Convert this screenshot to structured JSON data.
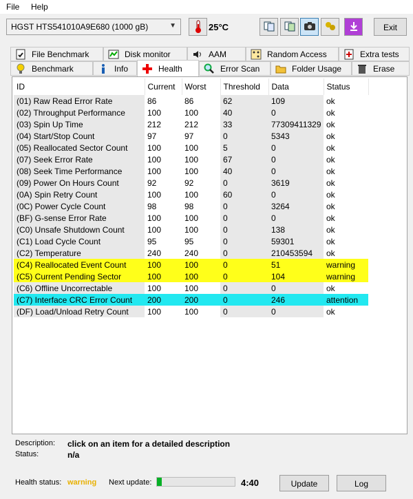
{
  "menu": {
    "file": "File",
    "help": "Help"
  },
  "toolbar": {
    "drive": "HGST HTS541010A9E680 (1000 gB)",
    "temperature": "25°C",
    "exit_label": "Exit"
  },
  "tabs_row1": [
    "File Benchmark",
    "Disk monitor",
    "AAM",
    "Random Access",
    "Extra tests"
  ],
  "tabs_row2": [
    "Benchmark",
    "Info",
    "Health",
    "Error Scan",
    "Folder Usage",
    "Erase"
  ],
  "table": {
    "headers": [
      "ID",
      "Current",
      "Worst",
      "Threshold",
      "Data",
      "Status"
    ],
    "rows": [
      [
        "(01) Raw Read Error Rate",
        "86",
        "86",
        "62",
        "109",
        "ok"
      ],
      [
        "(02) Throughput Performance",
        "100",
        "100",
        "40",
        "0",
        "ok"
      ],
      [
        "(03) Spin Up Time",
        "212",
        "212",
        "33",
        "77309411329",
        "ok"
      ],
      [
        "(04) Start/Stop Count",
        "97",
        "97",
        "0",
        "5343",
        "ok"
      ],
      [
        "(05) Reallocated Sector Count",
        "100",
        "100",
        "5",
        "0",
        "ok"
      ],
      [
        "(07) Seek Error Rate",
        "100",
        "100",
        "67",
        "0",
        "ok"
      ],
      [
        "(08) Seek Time Performance",
        "100",
        "100",
        "40",
        "0",
        "ok"
      ],
      [
        "(09) Power On Hours Count",
        "92",
        "92",
        "0",
        "3619",
        "ok"
      ],
      [
        "(0A) Spin Retry Count",
        "100",
        "100",
        "60",
        "0",
        "ok"
      ],
      [
        "(0C) Power Cycle Count",
        "98",
        "98",
        "0",
        "3264",
        "ok"
      ],
      [
        "(BF) G-sense Error Rate",
        "100",
        "100",
        "0",
        "0",
        "ok"
      ],
      [
        "(C0) Unsafe Shutdown Count",
        "100",
        "100",
        "0",
        "138",
        "ok"
      ],
      [
        "(C1) Load Cycle Count",
        "95",
        "95",
        "0",
        "59301",
        "ok"
      ],
      [
        "(C2) Temperature",
        "240",
        "240",
        "0",
        "210453594",
        "ok"
      ],
      [
        "(C4) Reallocated Event Count",
        "100",
        "100",
        "0",
        "51",
        "warning"
      ],
      [
        "(C5) Current Pending Sector",
        "100",
        "100",
        "0",
        "104",
        "warning"
      ],
      [
        "(C6) Offline Uncorrectable",
        "100",
        "100",
        "0",
        "0",
        "ok"
      ],
      [
        "(C7) Interface CRC Error Count",
        "200",
        "200",
        "0",
        "246",
        "attention"
      ],
      [
        "(DF) Load/Unload Retry Count",
        "100",
        "100",
        "0",
        "0",
        "ok"
      ]
    ]
  },
  "description": {
    "label": "Description:",
    "text": "click on an item for a detailed description",
    "status_label": "Status:",
    "status_value": "n/a"
  },
  "footer": {
    "health_label": "Health status:",
    "health_value": "warning",
    "next_label": "Next update:",
    "progress_fraction": 0.06,
    "time": "4:40",
    "update_label": "Update",
    "log_label": "Log"
  },
  "colors": {
    "warning_row": "#ffff1a",
    "attention_row": "#22e8f0",
    "health_warning_text": "#e8b000"
  }
}
